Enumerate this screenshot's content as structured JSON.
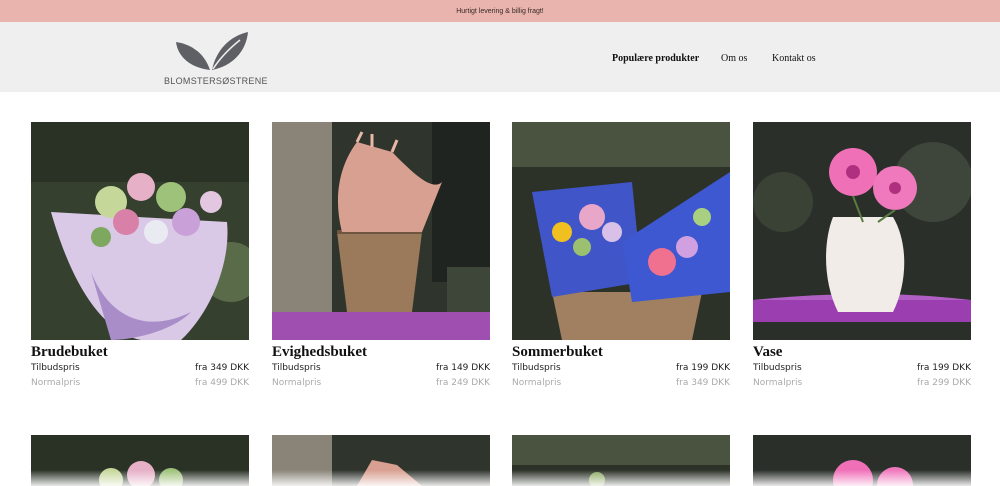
{
  "announcement": "Hurtigt levering & billig fragt!",
  "logo": {
    "text": "BLOMSTERSØSTRENE"
  },
  "nav": [
    {
      "label": "Populære produkter"
    },
    {
      "label": "Om os"
    },
    {
      "label": "Kontakt os"
    }
  ],
  "products": [
    {
      "name": "Brudebuket",
      "offer_label": "Tilbudspris",
      "offer_price": "fra 349 DKK",
      "normal_label": "Normalpris",
      "normal_price": "fra 499 DKK"
    },
    {
      "name": "Evighedsbuket",
      "offer_label": "Tilbudspris",
      "offer_price": "fra 149 DKK",
      "normal_label": "Normalpris",
      "normal_price": "fra 249 DKK"
    },
    {
      "name": "Sommerbuket",
      "offer_label": "Tilbudspris",
      "offer_price": "fra 199 DKK",
      "normal_label": "Normalpris",
      "normal_price": "fra 349 DKK"
    },
    {
      "name": "Vase",
      "offer_label": "Tilbudspris",
      "offer_price": "fra 199 DKK",
      "normal_label": "Normalpris",
      "normal_price": "fra 299 DKK"
    }
  ],
  "colors": {
    "announcement_bg": "#e8b4ad",
    "header_bg": "#efefef",
    "normal_price": "#aaaaaa"
  }
}
